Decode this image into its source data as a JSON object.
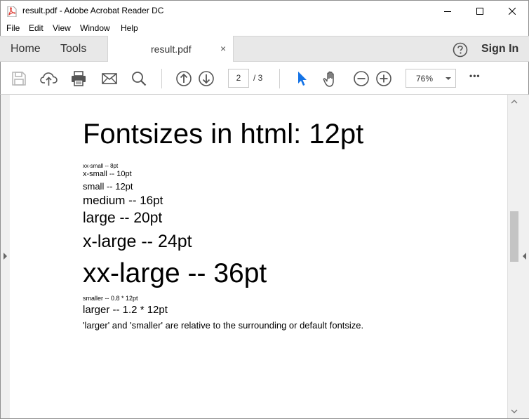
{
  "window": {
    "title": "result.pdf - Adobe Acrobat Reader DC"
  },
  "menu": [
    "File",
    "Edit",
    "View",
    "Window",
    "Help"
  ],
  "tabs": {
    "home": "Home",
    "tools": "Tools",
    "document": "result.pdf",
    "close_glyph": "×",
    "sign_in": "Sign In"
  },
  "toolbar": {
    "current_page": "2",
    "total_pages": "/ 3",
    "zoom": "76%",
    "more_glyph": "•••"
  },
  "document": {
    "heading": "Fontsizes in html: 12pt",
    "lines": [
      "xx-small -- 8pt",
      "x-small -- 10pt",
      "small -- 12pt",
      "medium -- 16pt",
      "large -- 20pt",
      "x-large -- 24pt",
      "xx-large -- 36pt",
      "smaller -- 0.8 * 12pt",
      "larger -- 1.2 * 12pt",
      "'larger' and 'smaller' are relative to the surrounding or default fontsize."
    ]
  },
  "colors": {
    "accent_pointer": "#1473e6",
    "pdf_icon_red": "#d9261c"
  }
}
